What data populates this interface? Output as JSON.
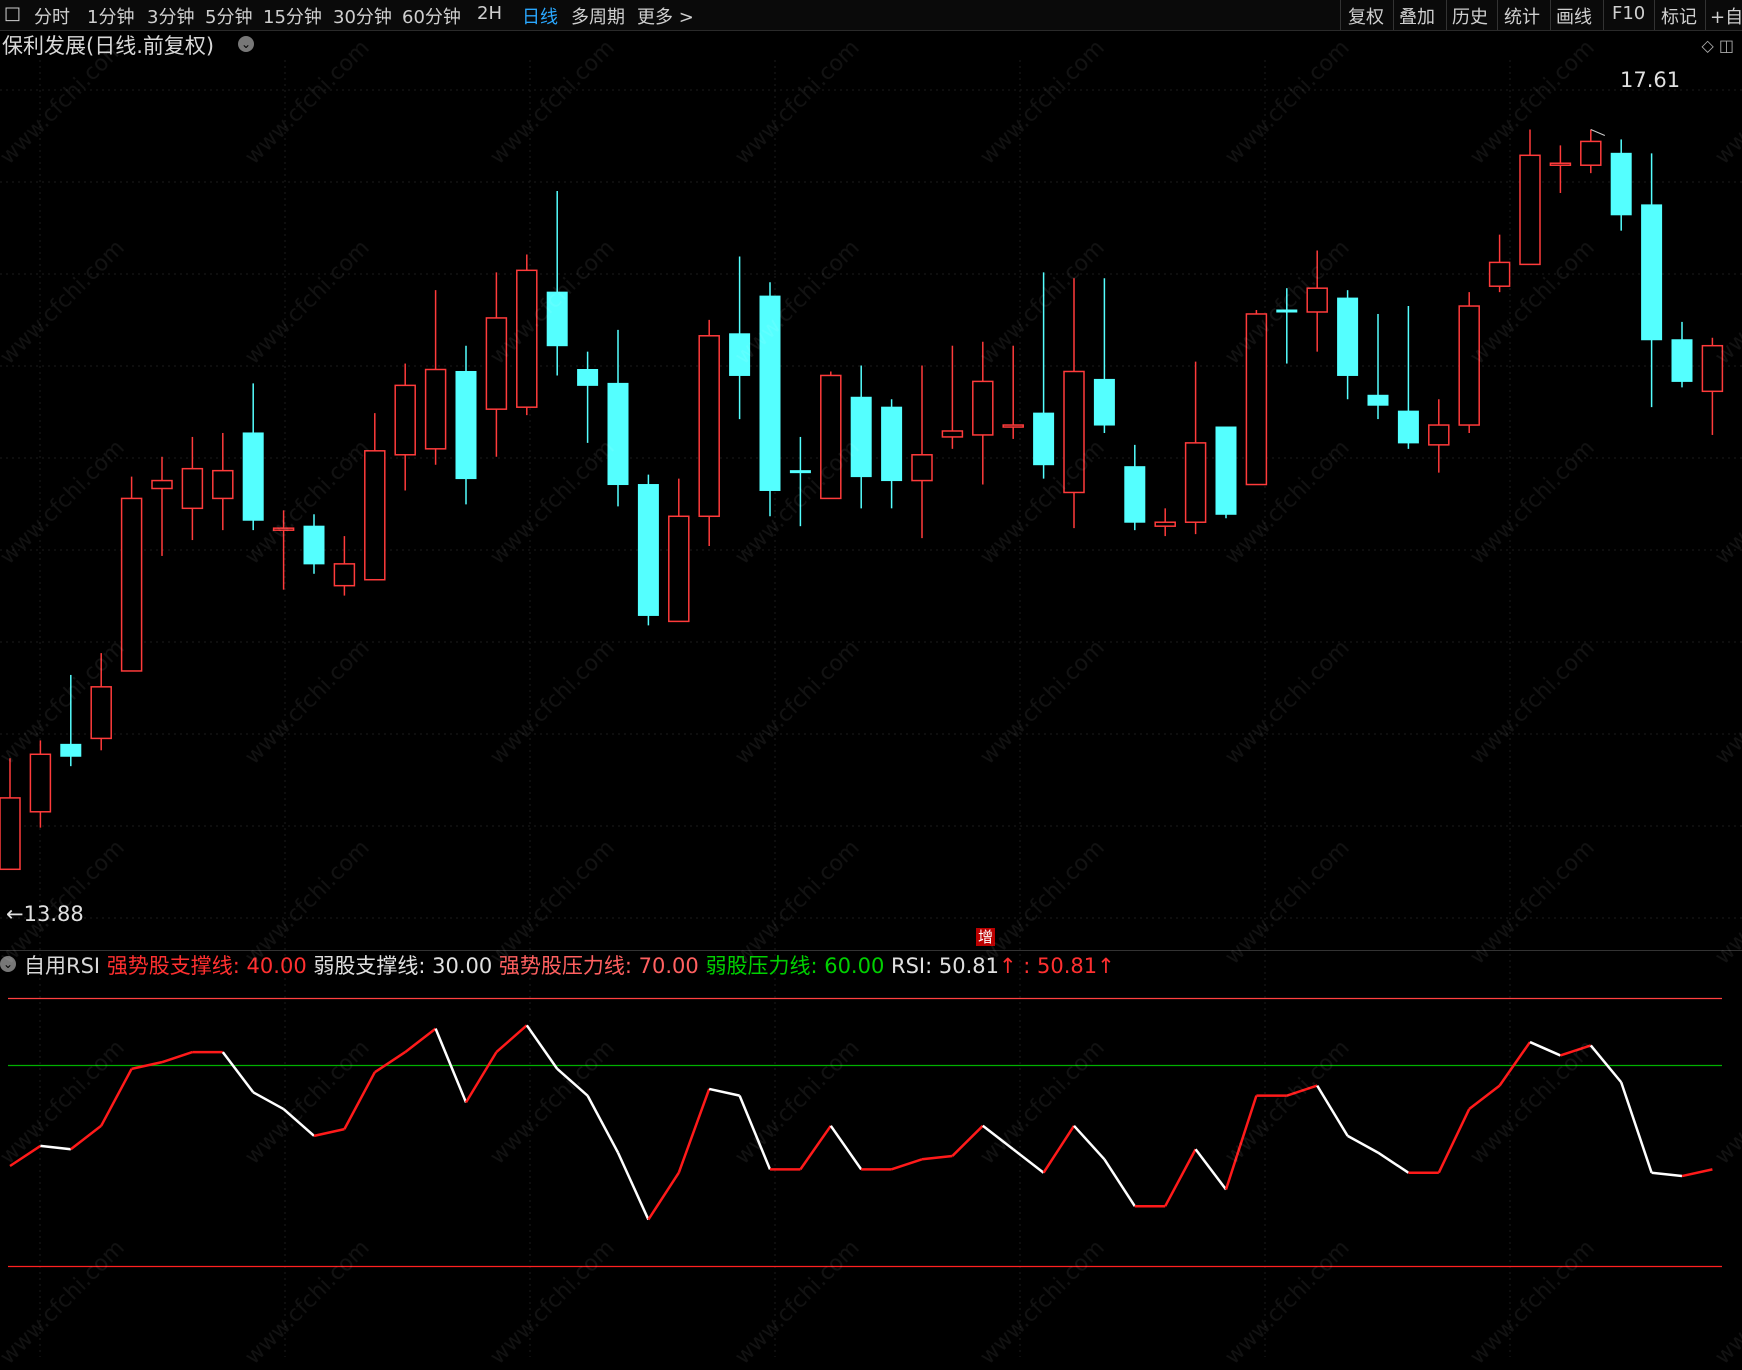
{
  "toolbar": {
    "square_icon": "□",
    "periods": [
      "分时",
      "1分钟",
      "3分钟",
      "5分钟",
      "15分钟",
      "30分钟",
      "60分钟",
      "2H",
      "日线",
      "多周期",
      "更多 >"
    ],
    "active_period": "日线",
    "right_items": [
      "复权",
      "叠加",
      "历史",
      "统计",
      "画线",
      "F10",
      "标记",
      "+自"
    ]
  },
  "title": "保利发展(日线.前复权)",
  "labels": {
    "high": "17.61",
    "low": "←13.88",
    "zeng": "增"
  },
  "rsi_legend": {
    "name": "自用RSI",
    "items": [
      {
        "text": "强势股支撑线: 40.00",
        "color": "#ff3030"
      },
      {
        "text": "弱股支撑线: 30.00",
        "color": "#e0e0e0"
      },
      {
        "text": "强势股压力线: 70.00",
        "color": "#ff6060"
      },
      {
        "text": "弱股压力线: 60.00",
        "color": "#00d000"
      },
      {
        "text": "RSI: 50.81",
        "color": "#e0e0e0"
      },
      {
        "text": "↑",
        "color": "#ff3030"
      },
      {
        "text": "  : 50.81",
        "color": "#ff3030"
      },
      {
        "text": "↑",
        "color": "#ff3030"
      }
    ]
  },
  "watermark_text": "www.cfchi.com",
  "colors": {
    "up": "#ff3b3b",
    "down": "#54ffff",
    "rsi_up": "#ff1a1a",
    "rsi_down": "#ffffff",
    "line_70": "#ff4040",
    "line_60": "#00b000",
    "line_30": "#ff2020"
  },
  "chart_data": {
    "type": "candlestick",
    "price_range": [
      13.7,
      17.9
    ],
    "candles": [
      {
        "o": 13.88,
        "c": 14.24,
        "h": 14.44,
        "l": 13.88
      },
      {
        "o": 14.17,
        "c": 14.46,
        "h": 14.53,
        "l": 14.09
      },
      {
        "o": 14.51,
        "c": 14.45,
        "h": 14.86,
        "l": 14.4
      },
      {
        "o": 14.54,
        "c": 14.8,
        "h": 14.97,
        "l": 14.48
      },
      {
        "o": 14.88,
        "c": 15.75,
        "h": 15.86,
        "l": 14.88
      },
      {
        "o": 15.8,
        "c": 15.84,
        "h": 15.96,
        "l": 15.46
      },
      {
        "o": 15.7,
        "c": 15.9,
        "h": 16.06,
        "l": 15.54
      },
      {
        "o": 15.75,
        "c": 15.89,
        "h": 16.08,
        "l": 15.59
      },
      {
        "o": 16.08,
        "c": 15.64,
        "h": 16.33,
        "l": 15.59
      },
      {
        "o": 15.59,
        "c": 15.6,
        "h": 15.69,
        "l": 15.29
      },
      {
        "o": 15.61,
        "c": 15.42,
        "h": 15.67,
        "l": 15.37
      },
      {
        "o": 15.31,
        "c": 15.42,
        "h": 15.56,
        "l": 15.26
      },
      {
        "o": 15.34,
        "c": 15.99,
        "h": 16.18,
        "l": 15.34
      },
      {
        "o": 15.97,
        "c": 16.32,
        "h": 16.43,
        "l": 15.79
      },
      {
        "o": 16.0,
        "c": 16.4,
        "h": 16.8,
        "l": 15.92
      },
      {
        "o": 16.39,
        "c": 15.85,
        "h": 16.52,
        "l": 15.72
      },
      {
        "o": 16.2,
        "c": 16.66,
        "h": 16.89,
        "l": 15.96
      },
      {
        "o": 16.21,
        "c": 16.9,
        "h": 16.98,
        "l": 16.17
      },
      {
        "o": 16.79,
        "c": 16.52,
        "h": 17.3,
        "l": 16.37
      },
      {
        "o": 16.4,
        "c": 16.32,
        "h": 16.49,
        "l": 16.03
      },
      {
        "o": 16.33,
        "c": 15.82,
        "h": 16.6,
        "l": 15.71
      },
      {
        "o": 15.82,
        "c": 15.16,
        "h": 15.87,
        "l": 15.11
      },
      {
        "o": 15.13,
        "c": 15.66,
        "h": 15.85,
        "l": 15.13
      },
      {
        "o": 15.66,
        "c": 16.57,
        "h": 16.65,
        "l": 15.51
      },
      {
        "o": 16.58,
        "c": 16.37,
        "h": 16.97,
        "l": 16.15
      },
      {
        "o": 16.77,
        "c": 15.79,
        "h": 16.84,
        "l": 15.66
      },
      {
        "o": 15.89,
        "c": 15.88,
        "h": 16.06,
        "l": 15.61
      },
      {
        "o": 15.75,
        "c": 16.37,
        "h": 16.39,
        "l": 15.75
      },
      {
        "o": 16.26,
        "c": 15.86,
        "h": 16.42,
        "l": 15.7
      },
      {
        "o": 16.21,
        "c": 15.84,
        "h": 16.25,
        "l": 15.7
      },
      {
        "o": 15.84,
        "c": 15.97,
        "h": 16.42,
        "l": 15.55
      },
      {
        "o": 16.06,
        "c": 16.09,
        "h": 16.52,
        "l": 16.0
      },
      {
        "o": 16.07,
        "c": 16.34,
        "h": 16.54,
        "l": 15.82
      },
      {
        "o": 16.12,
        "c": 16.12,
        "h": 16.52,
        "l": 16.05
      },
      {
        "o": 16.18,
        "c": 15.92,
        "h": 16.89,
        "l": 15.85
      },
      {
        "o": 15.78,
        "c": 16.39,
        "h": 16.86,
        "l": 15.6
      },
      {
        "o": 16.35,
        "c": 16.12,
        "h": 16.86,
        "l": 16.08
      },
      {
        "o": 15.91,
        "c": 15.63,
        "h": 16.02,
        "l": 15.59
      },
      {
        "o": 15.61,
        "c": 15.63,
        "h": 15.7,
        "l": 15.56
      },
      {
        "o": 15.63,
        "c": 16.03,
        "h": 16.44,
        "l": 15.57
      },
      {
        "o": 16.11,
        "c": 15.67,
        "h": 16.11,
        "l": 15.65
      },
      {
        "o": 15.82,
        "c": 16.68,
        "h": 16.7,
        "l": 15.82
      },
      {
        "o": 16.7,
        "c": 16.69,
        "h": 16.81,
        "l": 16.43
      },
      {
        "o": 16.69,
        "c": 16.81,
        "h": 17.0,
        "l": 16.49
      },
      {
        "o": 16.76,
        "c": 16.37,
        "h": 16.8,
        "l": 16.25
      },
      {
        "o": 16.27,
        "c": 16.22,
        "h": 16.68,
        "l": 16.15
      },
      {
        "o": 16.19,
        "c": 16.03,
        "h": 16.72,
        "l": 16.0
      },
      {
        "o": 16.02,
        "c": 16.12,
        "h": 16.25,
        "l": 15.88
      },
      {
        "o": 16.12,
        "c": 16.72,
        "h": 16.79,
        "l": 16.08
      },
      {
        "o": 16.82,
        "c": 16.94,
        "h": 17.08,
        "l": 16.79
      },
      {
        "o": 16.93,
        "c": 17.48,
        "h": 17.61,
        "l": 17.46
      },
      {
        "o": 17.43,
        "c": 17.44,
        "h": 17.53,
        "l": 17.29
      },
      {
        "o": 17.43,
        "c": 17.55,
        "h": 17.61,
        "l": 17.39
      },
      {
        "o": 17.49,
        "c": 17.18,
        "h": 17.56,
        "l": 17.1
      },
      {
        "o": 17.23,
        "c": 16.55,
        "h": 17.49,
        "l": 16.21
      },
      {
        "o": 16.55,
        "c": 16.34,
        "h": 16.64,
        "l": 16.31
      },
      {
        "o": 16.29,
        "c": 16.52,
        "h": 16.56,
        "l": 16.07
      }
    ],
    "rsi": {
      "levels": [
        70,
        60,
        30
      ],
      "range": [
        25,
        75
      ],
      "values": [
        45.0,
        48.0,
        47.5,
        51.0,
        59.5,
        60.5,
        62.0,
        62.0,
        56.0,
        53.5,
        49.5,
        50.5,
        59.0,
        62.0,
        65.5,
        54.5,
        62.0,
        66.0,
        59.5,
        55.5,
        47.0,
        37.0,
        44.0,
        56.5,
        55.5,
        44.5,
        44.5,
        51.0,
        44.5,
        44.5,
        46.0,
        46.5,
        51.0,
        47.5,
        44.0,
        51.0,
        46.0,
        39.0,
        39.0,
        47.5,
        41.5,
        55.5,
        55.5,
        57.0,
        49.5,
        47.0,
        44.0,
        44.0,
        53.5,
        57.0,
        63.5,
        61.5,
        63.0,
        57.5,
        44.0,
        43.5,
        44.5
      ]
    }
  }
}
